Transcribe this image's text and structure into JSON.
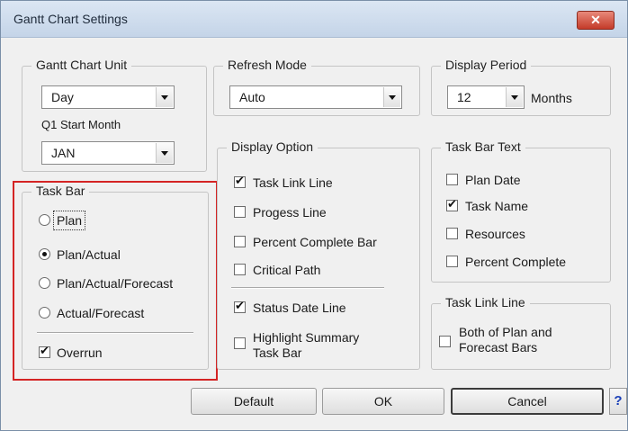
{
  "window": {
    "title": "Gantt Chart Settings",
    "close_label": "✕"
  },
  "gantt_unit": {
    "label": "Gantt Chart Unit",
    "unit_value": "Day",
    "q1_label": "Q1 Start Month",
    "q1_value": "JAN"
  },
  "refresh": {
    "label": "Refresh Mode",
    "value": "Auto"
  },
  "display_period": {
    "label": "Display Period",
    "value": "12",
    "unit": "Months"
  },
  "task_bar": {
    "label": "Task Bar",
    "options": [
      {
        "label": "Plan",
        "selected": false
      },
      {
        "label": "Plan/Actual",
        "selected": true
      },
      {
        "label": "Plan/Actual/Forecast",
        "selected": false
      },
      {
        "label": "Actual/Forecast",
        "selected": false
      }
    ],
    "overrun": {
      "label": "Overrun",
      "checked": true
    }
  },
  "display_option": {
    "label": "Display Option",
    "items": [
      {
        "label": "Task Link Line",
        "checked": true
      },
      {
        "label": "Progess Line",
        "checked": false
      },
      {
        "label": "Percent Complete Bar",
        "checked": false
      },
      {
        "label": "Critical Path",
        "checked": false
      },
      {
        "label": "Status Date Line",
        "checked": true
      },
      {
        "label": "Highlight Summary\nTask Bar",
        "checked": false
      }
    ]
  },
  "task_bar_text": {
    "label": "Task Bar Text",
    "items": [
      {
        "label": "Plan Date",
        "checked": false
      },
      {
        "label": "Task Name",
        "checked": true
      },
      {
        "label": "Resources",
        "checked": false
      },
      {
        "label": "Percent Complete",
        "checked": false
      }
    ]
  },
  "task_link_line": {
    "label": "Task Link Line",
    "option": {
      "label": "Both of Plan and\nForecast Bars",
      "checked": false
    }
  },
  "buttons": {
    "default": "Default",
    "ok": "OK",
    "cancel": "Cancel",
    "help": "?"
  }
}
